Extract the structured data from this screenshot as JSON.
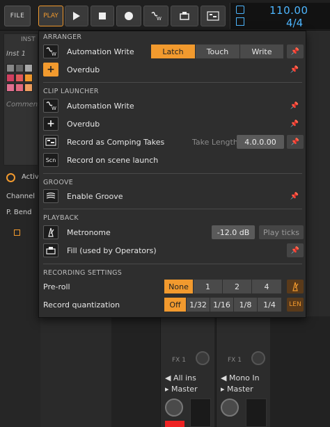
{
  "topbar": {
    "file_label": "FILE",
    "play_label": "PLAY",
    "tempo": "110.00",
    "time_signature": "4/4",
    "buttons": [
      "play-icon",
      "stop-icon",
      "record-icon",
      "automation-write-icon",
      "fill-icon",
      "comping-icon"
    ]
  },
  "background": {
    "inst_title": "INST",
    "inst_name": "Inst 1",
    "comment": "Comment",
    "active_label": "Activ",
    "channel_label": "Channel",
    "pbend_label": "P. Bend",
    "strips": [
      {
        "fx_label": "FX 1",
        "input": "All ins",
        "output": "Master"
      },
      {
        "fx_label": "FX 1",
        "input": "Mono In",
        "output": "Master"
      }
    ]
  },
  "panel": {
    "arranger": {
      "title": "ARRANGER",
      "automation_write": "Automation Write",
      "modes": [
        "Latch",
        "Touch",
        "Write"
      ],
      "selected_mode": "Latch",
      "overdub": "Overdub"
    },
    "clip_launcher": {
      "title": "CLIP LAUNCHER",
      "automation_write": "Automation Write",
      "overdub": "Overdub",
      "comping": "Record as Comping Takes",
      "take_length_label": "Take Length",
      "take_length_value": "4.0.0.00",
      "scene_launch": "Record on scene launch"
    },
    "groove": {
      "title": "GROOVE",
      "enable": "Enable Groove"
    },
    "playback": {
      "title": "PLAYBACK",
      "metronome": "Metronome",
      "metronome_level": "-12.0 dB",
      "play_ticks": "Play ticks",
      "fill": "Fill (used by Operators)"
    },
    "recording_settings": {
      "title": "RECORDING SETTINGS",
      "preroll_label": "Pre-roll",
      "preroll_options": [
        "None",
        "1",
        "2",
        "4"
      ],
      "preroll_selected": "None",
      "quant_label": "Record quantization",
      "quant_options": [
        "Off",
        "1/32",
        "1/16",
        "1/8",
        "1/4"
      ],
      "quant_selected": "Off",
      "scn_icon_text": "Scn",
      "len_icon_text": "LEN"
    }
  },
  "colors": {
    "accent": "#f29a2e",
    "display": "#4db6ff",
    "panel_bg": "#2e2e2e"
  }
}
